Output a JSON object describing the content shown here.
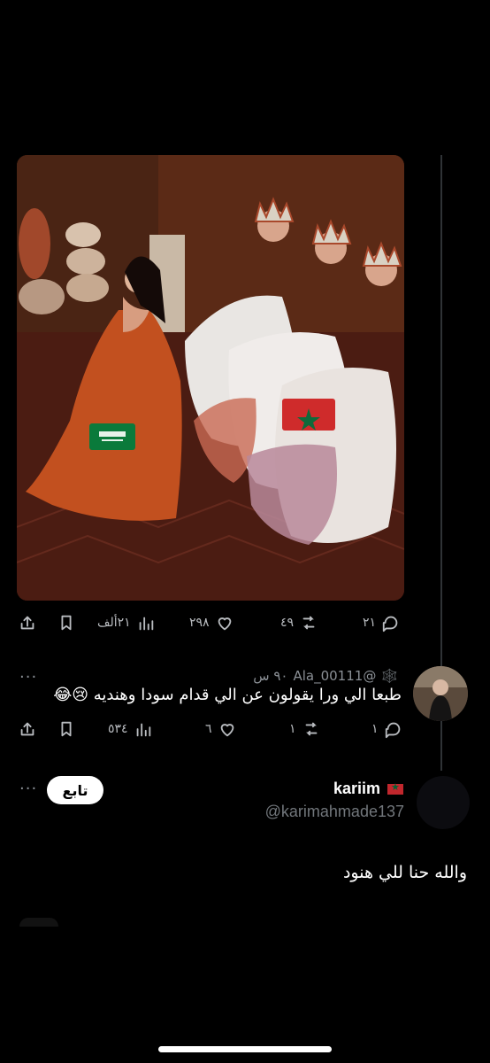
{
  "tweet": {
    "actions": {
      "replies": "٢١",
      "retweets": "٤٩",
      "likes": "٢٩٨",
      "views": "٢١ألف"
    },
    "media": {
      "flags": [
        "saudi-flag",
        "morocco-flag"
      ]
    }
  },
  "reply": {
    "handle": "@Ala_00111",
    "time": "٩٠ س",
    "text": "طبعا الي ورا يقولون عن الي قدام سودا وهنديه",
    "emojis": "😢😂",
    "actions": {
      "replies": "١",
      "retweets": "١",
      "likes": "٦",
      "views": "٥٣٤"
    },
    "more_label": "···"
  },
  "next_post": {
    "name": "kariim",
    "handle": "@karimahmade137",
    "follow_label": "تابع",
    "text": "والله حنا للي هنود",
    "more_label": "···"
  },
  "colors": {
    "background": "#000000",
    "text_primary": "#e7e9ea",
    "text_secondary": "#71767b"
  }
}
